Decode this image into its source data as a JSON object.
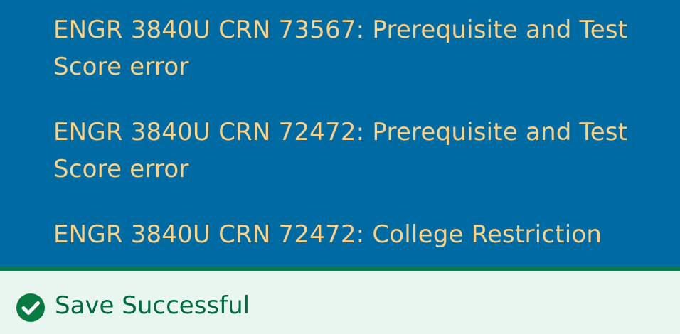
{
  "errors": [
    {
      "text": "ENGR 3840U CRN 73567: Prerequisite and Test Score error"
    },
    {
      "text": "ENGR 3840U CRN 72472: Prerequisite and Test Score error"
    },
    {
      "text": "ENGR 3840U CRN 72472: College Restriction"
    }
  ],
  "notification": {
    "icon": "check-circle-icon",
    "message": "Save Successful"
  },
  "colors": {
    "panel_bg": "#006ba3",
    "error_text": "#f6d28c",
    "success_bg": "#e9f6f0",
    "success_text": "#006b3f",
    "success_border": "#0c7a4a"
  }
}
